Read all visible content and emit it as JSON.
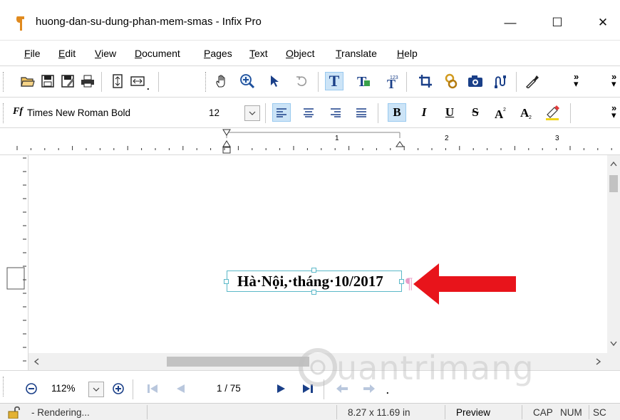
{
  "window": {
    "title": "huong-dan-su-dung-phan-mem-smas - Infix Pro",
    "minimize": "—",
    "maximize": "☐",
    "close": "✕"
  },
  "menu": {
    "items": [
      {
        "label": "File",
        "u": "F",
        "rest": "ile"
      },
      {
        "label": "Edit",
        "u": "E",
        "rest": "dit"
      },
      {
        "label": "View",
        "u": "V",
        "rest": "iew"
      },
      {
        "label": "Document",
        "u": "D",
        "rest": "ocument"
      },
      {
        "label": "Pages",
        "u": "P",
        "rest": "ages"
      },
      {
        "label": "Text",
        "u": "T",
        "rest": "ext"
      },
      {
        "label": "Object",
        "u": "O",
        "rest": "bject"
      },
      {
        "label": "Translate",
        "u": "T",
        "rest": "ranslate"
      },
      {
        "label": "Help",
        "u": "H",
        "rest": "elp"
      }
    ]
  },
  "formatting": {
    "font_name": "Times New Roman Bold",
    "font_size": "12"
  },
  "document": {
    "text": "Hà·Nội,·tháng·10/2017",
    "pilcrow": "¶"
  },
  "ruler": {
    "marks": [
      "1",
      "2",
      "3"
    ]
  },
  "navigation": {
    "zoom": "112%",
    "page": "1 / 75"
  },
  "status": {
    "state": "- Rendering...",
    "page_size": "8.27 x 11.69 in",
    "mode": "Preview",
    "cap": "CAP",
    "num": "NUM",
    "scroll": "SC"
  },
  "watermark": "uantrimang",
  "colors": {
    "arrow": "#e8141b",
    "active_button": "#cce4f7",
    "selection_border": "#5bb8c8",
    "pilcrow": "#e99bc7"
  }
}
